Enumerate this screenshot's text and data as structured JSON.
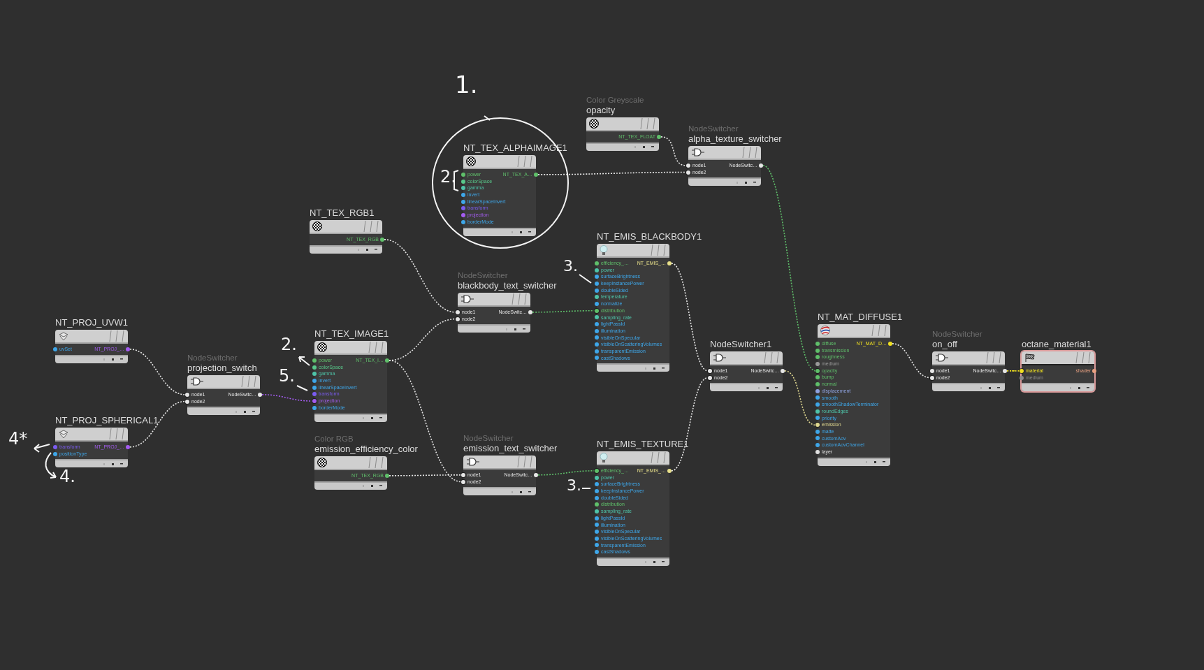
{
  "nodes": [
    {
      "type_label": "Color Greyscale",
      "name": "opacity",
      "kind": "texture",
      "selected": false,
      "output": {
        "label": "NT_TEX_FLOAT",
        "color": "#5fbf6a"
      }
    },
    {
      "type_label": "NodeSwitcher",
      "name": "alpha_texture_switcher",
      "kind": "switch",
      "selected": false,
      "inputs": [
        {
          "label": "node1",
          "color": "#e6e6e6",
          "linked": true
        },
        {
          "label": "node2",
          "color": "#e6e6e6",
          "linked": true
        }
      ],
      "output": {
        "label": "NodeSwitc…",
        "color": "#e6e6e6"
      }
    },
    {
      "name": "NT_TEX_ALPHAIMAGE1",
      "kind": "texture",
      "selected": false,
      "inputs": [
        {
          "label": "power",
          "color": "#5fbf6a",
          "linked": false
        },
        {
          "label": "colorSpace",
          "color": "#58c88a",
          "linked": false
        },
        {
          "label": "gamma",
          "color": "#4ec3a8",
          "linked": false
        },
        {
          "label": "invert",
          "color": "#3ea6e8",
          "linked": false
        },
        {
          "label": "linearSpaceInvert",
          "color": "#3ea6e8",
          "linked": false
        },
        {
          "label": "transform",
          "color": "#7b5cf0",
          "linked": false
        },
        {
          "label": "projection",
          "color": "#a45cf0",
          "linked": false
        },
        {
          "label": "borderMode",
          "color": "#3ea6e8",
          "linked": false
        }
      ],
      "output": {
        "label": "NT_TEX_A…",
        "color": "#5fbf6a"
      }
    },
    {
      "name": "NT_TEX_RGB1",
      "kind": "texture",
      "selected": false,
      "output": {
        "label": "NT_TEX_RGB",
        "color": "#5fbf6a"
      }
    },
    {
      "type_label": "NodeSwitcher",
      "name": "blackbody_text_switcher",
      "kind": "switch",
      "selected": false,
      "inputs": [
        {
          "label": "node1",
          "color": "#e6e6e6",
          "linked": true
        },
        {
          "label": "node2",
          "color": "#e6e6e6",
          "linked": true
        }
      ],
      "output": {
        "label": "NodeSwitc…",
        "color": "#e6e6e6"
      }
    },
    {
      "name": "NT_EMIS_BLACKBODY1",
      "kind": "emission",
      "selected": false,
      "inputs": [
        {
          "label": "efficiency_…",
          "color": "#5fbf6a",
          "linked": false
        },
        {
          "label": "power",
          "color": "#4ec3a8",
          "linked": false
        },
        {
          "label": "surfaceBrightness",
          "color": "#3ea6e8",
          "linked": false
        },
        {
          "label": "keepInstancePower",
          "color": "#3ea6e8",
          "linked": false
        },
        {
          "label": "doubleSided",
          "color": "#3ea6e8",
          "linked": false
        },
        {
          "label": "temperature",
          "color": "#4ec3a8",
          "linked": false
        },
        {
          "label": "normalize",
          "color": "#3ea6e8",
          "linked": false
        },
        {
          "label": "distribution",
          "color": "#5fbf6a",
          "linked": true
        },
        {
          "label": "sampling_rate",
          "color": "#4ec3a8",
          "linked": false
        },
        {
          "label": "lightPassId",
          "color": "#3ea6e8",
          "linked": false
        },
        {
          "label": "illumination",
          "color": "#3ea6e8",
          "linked": false
        },
        {
          "label": "visibleOnSpecular",
          "color": "#3ea6e8",
          "linked": false
        },
        {
          "label": "visibleOnScatteringVolumes",
          "color": "#3ea6e8",
          "linked": false
        },
        {
          "label": "transparentEmission",
          "color": "#3ea6e8",
          "linked": false
        },
        {
          "label": "castShadows",
          "color": "#3ea6e8",
          "linked": false
        }
      ],
      "output": {
        "label": "NT_EMIS_…",
        "color": "#e8e08a"
      }
    },
    {
      "name": "NT_MAT_DIFFUSE1",
      "kind": "material",
      "selected": false,
      "inputs": [
        {
          "label": "diffuse",
          "color": "#5fbf6a",
          "linked": false
        },
        {
          "label": "transmission",
          "color": "#5fbf6a",
          "linked": false
        },
        {
          "label": "roughness",
          "color": "#5fbf6a",
          "linked": false
        },
        {
          "label": "medium",
          "color": "#9a9a9a",
          "linked": false
        },
        {
          "label": "opacity",
          "color": "#5fbf6a",
          "linked": true
        },
        {
          "label": "bump",
          "color": "#5fbf6a",
          "linked": false
        },
        {
          "label": "normal",
          "color": "#5fbf6a",
          "linked": false
        },
        {
          "label": "displacement",
          "color": "#8fa3e0",
          "linked": false
        },
        {
          "label": "smooth",
          "color": "#3ea6e8",
          "linked": false
        },
        {
          "label": "smoothShadowTerminator",
          "color": "#3ea6e8",
          "linked": false
        },
        {
          "label": "roundEdges",
          "color": "#4ec3a8",
          "linked": false
        },
        {
          "label": "priority",
          "color": "#3ea6e8",
          "linked": false
        },
        {
          "label": "emission",
          "color": "#e0d890",
          "linked": true
        },
        {
          "label": "matte",
          "color": "#3ea6e8",
          "linked": false
        },
        {
          "label": "customAov",
          "color": "#3ea6e8",
          "linked": false
        },
        {
          "label": "customAovChannel",
          "color": "#3ea6e8",
          "linked": false
        },
        {
          "label": "layer",
          "color": "#e0e0e0",
          "linked": false
        }
      ],
      "output": {
        "label": "NT_MAT_D…",
        "color": "#f0e020"
      }
    },
    {
      "name": "NT_PROJ_UVW1",
      "kind": "projection",
      "selected": false,
      "inputs": [
        {
          "label": "uvSet",
          "color": "#3ea6e8",
          "linked": false
        }
      ],
      "output": {
        "label": "NT_PROJ_…",
        "color": "#a45cf0"
      }
    },
    {
      "name": "NT_TEX_IMAGE1",
      "kind": "texture",
      "selected": false,
      "inputs": [
        {
          "label": "power",
          "color": "#5fbf6a",
          "linked": false
        },
        {
          "label": "colorSpace",
          "color": "#58c88a",
          "linked": false
        },
        {
          "label": "gamma",
          "color": "#4ec3a8",
          "linked": false
        },
        {
          "label": "invert",
          "color": "#3ea6e8",
          "linked": false
        },
        {
          "label": "linearSpaceInvert",
          "color": "#3ea6e8",
          "linked": false
        },
        {
          "label": "transform",
          "color": "#7b5cf0",
          "linked": false
        },
        {
          "label": "projection",
          "color": "#a45cf0",
          "linked": true
        },
        {
          "label": "borderMode",
          "color": "#3ea6e8",
          "linked": false
        }
      ],
      "output": {
        "label": "NT_TEX_I…",
        "color": "#5fbf6a"
      }
    },
    {
      "name": "NodeSwitcher1",
      "kind": "switch",
      "selected": false,
      "inputs": [
        {
          "label": "node1",
          "color": "#e6e6e6",
          "linked": true
        },
        {
          "label": "node2",
          "color": "#e6e6e6",
          "linked": true
        }
      ],
      "output": {
        "label": "NodeSwitc…",
        "color": "#e6e6e6"
      }
    },
    {
      "type_label": "NodeSwitcher",
      "name": "on_off",
      "kind": "switch",
      "selected": false,
      "inputs": [
        {
          "label": "node1",
          "color": "#e6e6e6",
          "linked": false
        },
        {
          "label": "node2",
          "color": "#e6e6e6",
          "linked": true
        }
      ],
      "output": {
        "label": "NodeSwitc…",
        "color": "#e6e6e6"
      }
    },
    {
      "name": "octane_material1",
      "kind": "output",
      "selected": true,
      "inputs": [
        {
          "label": "material",
          "color": "#f0e020",
          "linked": true
        },
        {
          "label": "medium",
          "color": "#8a8a8a",
          "linked": false
        }
      ],
      "output": {
        "label": "shader",
        "color": "#e8a080"
      }
    },
    {
      "type_label": "NodeSwitcher",
      "name": "projection_switch",
      "kind": "switch",
      "selected": false,
      "inputs": [
        {
          "label": "node1",
          "color": "#e6e6e6",
          "linked": true
        },
        {
          "label": "node2",
          "color": "#e6e6e6",
          "linked": true
        }
      ],
      "output": {
        "label": "NodeSwitc…",
        "color": "#e6e6e6"
      }
    },
    {
      "name": "NT_PROJ_SPHERICAL1",
      "kind": "projection",
      "selected": false,
      "inputs": [
        {
          "label": "transform",
          "color": "#7b5cf0",
          "linked": false
        },
        {
          "label": "positionType",
          "color": "#3ea6e8",
          "linked": false
        }
      ],
      "output": {
        "label": "NT_PROJ_…",
        "color": "#a45cf0"
      }
    },
    {
      "type_label": "Color RGB",
      "name": "emission_efficiency_color",
      "kind": "texture",
      "selected": false,
      "output": {
        "label": "NT_TEX_RGB",
        "color": "#5fbf6a"
      }
    },
    {
      "type_label": "NodeSwitcher",
      "name": "emission_text_switcher",
      "kind": "switch",
      "selected": false,
      "inputs": [
        {
          "label": "node1",
          "color": "#e6e6e6",
          "linked": true
        },
        {
          "label": "node2",
          "color": "#e6e6e6",
          "linked": true
        }
      ],
      "output": {
        "label": "NodeSwitc…",
        "color": "#e6e6e6"
      }
    },
    {
      "name": "NT_EMIS_TEXTURE1",
      "kind": "emission",
      "selected": false,
      "inputs": [
        {
          "label": "efficiency_…",
          "color": "#5fbf6a",
          "linked": true
        },
        {
          "label": "power",
          "color": "#4ec3a8",
          "linked": false
        },
        {
          "label": "surfaceBrightness",
          "color": "#3ea6e8",
          "linked": false
        },
        {
          "label": "keepInstancePower",
          "color": "#3ea6e8",
          "linked": false
        },
        {
          "label": "doubleSided",
          "color": "#3ea6e8",
          "linked": false
        },
        {
          "label": "distribution",
          "color": "#5fbf6a",
          "linked": false
        },
        {
          "label": "sampling_rate",
          "color": "#4ec3a8",
          "linked": false
        },
        {
          "label": "lightPassId",
          "color": "#3ea6e8",
          "linked": false
        },
        {
          "label": "illumination",
          "color": "#3ea6e8",
          "linked": false
        },
        {
          "label": "visibleOnSpecular",
          "color": "#3ea6e8",
          "linked": false
        },
        {
          "label": "visibleOnScatteringVolumes",
          "color": "#3ea6e8",
          "linked": false
        },
        {
          "label": "transparentEmission",
          "color": "#3ea6e8",
          "linked": false
        },
        {
          "label": "castShadows",
          "color": "#3ea6e8",
          "linked": false
        }
      ],
      "output": {
        "label": "NT_EMIS_…",
        "color": "#e8e08a"
      }
    }
  ],
  "annotations": [
    {
      "text": "1."
    },
    {
      "text": "2."
    },
    {
      "text": "3."
    },
    {
      "text": "2."
    },
    {
      "text": "5."
    },
    {
      "text": "4*"
    },
    {
      "text": "3."
    },
    {
      "text": "4."
    }
  ]
}
